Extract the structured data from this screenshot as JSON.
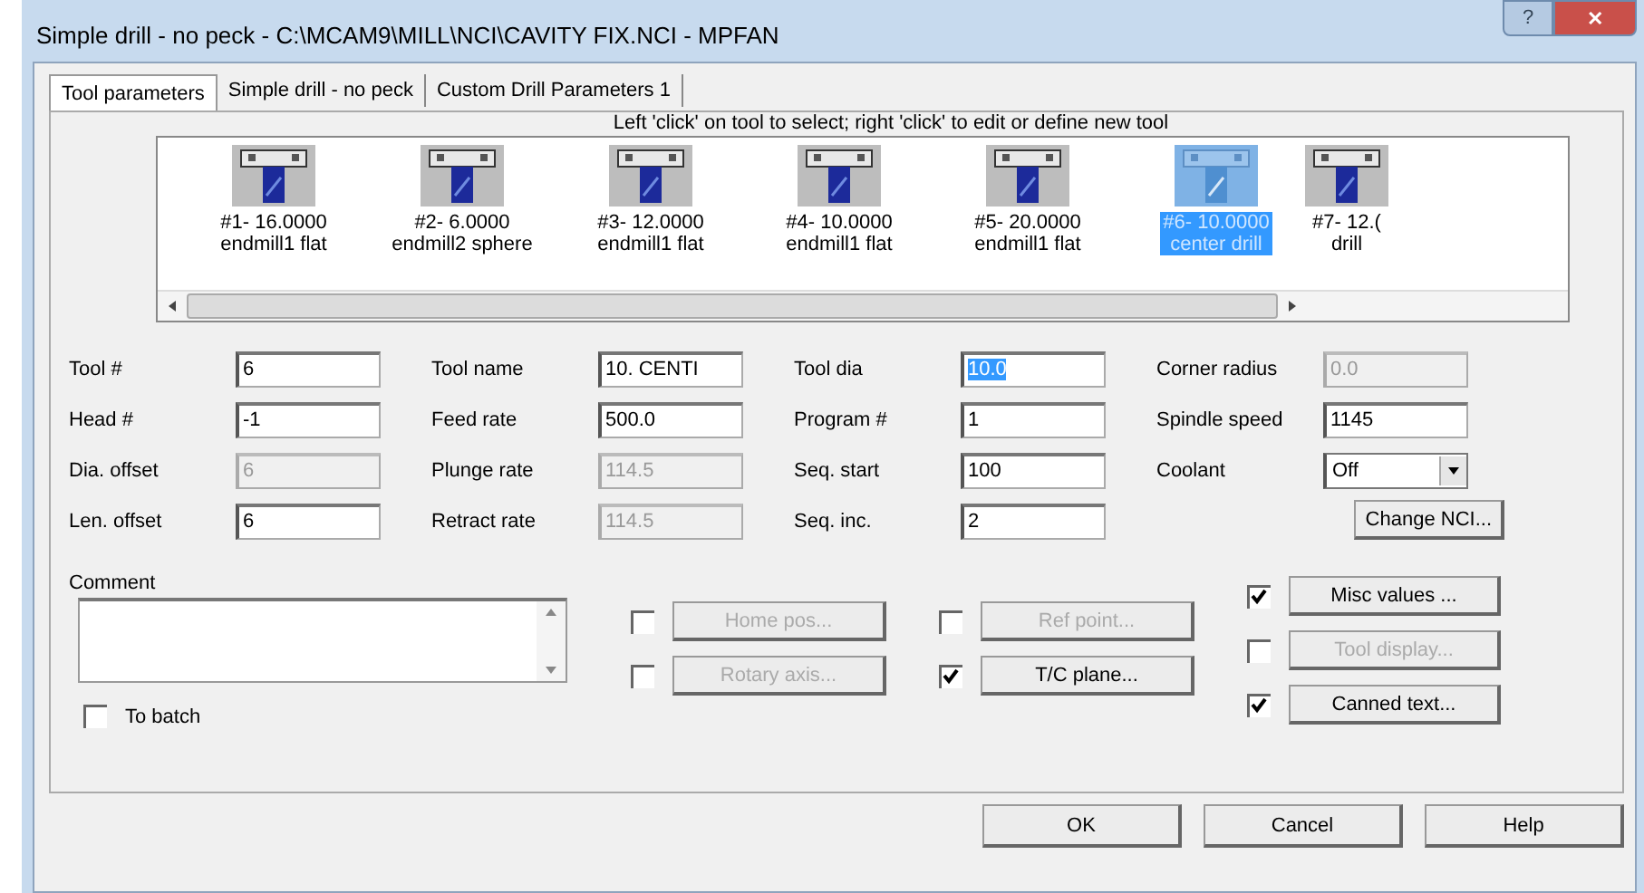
{
  "window": {
    "title": "Simple drill - no peck - C:\\MCAM9\\MILL\\NCI\\CAVITY FIX.NCI - MPFAN",
    "help_button": "?",
    "close_button": "✕"
  },
  "tabs": [
    {
      "label": "Tool parameters",
      "selected": true
    },
    {
      "label": "Simple drill - no peck",
      "selected": false
    },
    {
      "label": "Custom Drill Parameters 1",
      "selected": false
    }
  ],
  "tool_hint": "Left 'click' on tool to select; right 'click' to edit or define new tool",
  "tools": [
    {
      "number": "#1- 16.0000",
      "type": "endmill1 flat",
      "selected": false
    },
    {
      "number": "#2- 6.0000",
      "type": "endmill2 sphere",
      "selected": false
    },
    {
      "number": "#3- 12.0000",
      "type": "endmill1 flat",
      "selected": false
    },
    {
      "number": "#4- 10.0000",
      "type": "endmill1 flat",
      "selected": false
    },
    {
      "number": "#5- 20.0000",
      "type": "endmill1 flat",
      "selected": false
    },
    {
      "number": "#6- 10.0000",
      "type": "center drill",
      "selected": true
    },
    {
      "number": "#7- 12.(",
      "type": "drill",
      "selected": false
    }
  ],
  "field_columns": [
    [
      {
        "label": "Tool #",
        "kind": "text",
        "value": "6",
        "disabled": false
      },
      {
        "label": "Head #",
        "kind": "text",
        "value": "-1",
        "disabled": false
      },
      {
        "label": "Dia. offset",
        "kind": "text",
        "value": "6",
        "disabled": true
      },
      {
        "label": "Len. offset",
        "kind": "text",
        "value": "6",
        "disabled": false
      }
    ],
    [
      {
        "label": "Tool name",
        "kind": "text",
        "value": "10. CENTI",
        "disabled": false
      },
      {
        "label": "Feed rate",
        "kind": "text",
        "value": "500.0",
        "disabled": false
      },
      {
        "label": "Plunge rate",
        "kind": "text",
        "value": "114.5",
        "disabled": true
      },
      {
        "label": "Retract rate",
        "kind": "text",
        "value": "114.5",
        "disabled": true
      }
    ],
    [
      {
        "label": "Tool dia",
        "kind": "text",
        "value": "10.0",
        "disabled": false,
        "text_selected": true
      },
      {
        "label": "Program #",
        "kind": "text",
        "value": "1",
        "disabled": false
      },
      {
        "label": "Seq. start",
        "kind": "text",
        "value": "100",
        "disabled": false
      },
      {
        "label": "Seq. inc.",
        "kind": "text",
        "value": "2",
        "disabled": false
      }
    ],
    [
      {
        "label": "Corner radius",
        "kind": "text",
        "value": "0.0",
        "disabled": true
      },
      {
        "label": "Spindle speed",
        "kind": "text",
        "value": "1145",
        "disabled": false
      },
      {
        "label": "Coolant",
        "kind": "dropdown",
        "value": "Off"
      }
    ]
  ],
  "change_nci_button": "Change NCI...",
  "comment": {
    "label": "Comment"
  },
  "option_columns": [
    [
      {
        "label": "Home pos...",
        "checked": false,
        "disabled": true
      },
      {
        "label": "Rotary axis...",
        "checked": false,
        "disabled": true
      }
    ],
    [
      {
        "label": "Ref point...",
        "checked": false,
        "disabled": true
      },
      {
        "label": "T/C plane...",
        "checked": true,
        "disabled": false
      }
    ],
    [
      {
        "label": "Misc values ...",
        "checked": true,
        "disabled": false
      },
      {
        "label": "Tool display...",
        "checked": false,
        "disabled": true
      },
      {
        "label": "Canned text...",
        "checked": true,
        "disabled": false
      }
    ]
  ],
  "to_batch": {
    "label": "To batch",
    "checked": false
  },
  "buttons": [
    "OK",
    "Cancel",
    "Help"
  ]
}
